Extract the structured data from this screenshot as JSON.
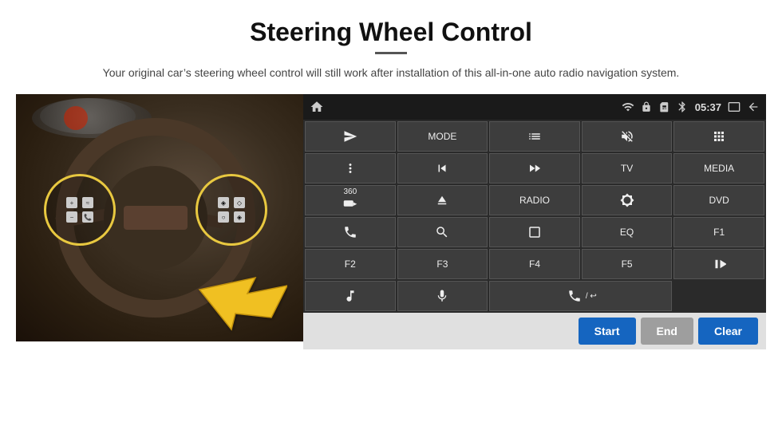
{
  "header": {
    "title": "Steering Wheel Control",
    "subtitle": "Your original car’s steering wheel control will still work after installation of this all-in-one auto radio navigation system."
  },
  "topbar": {
    "time": "05:37",
    "icons": [
      "wifi",
      "lock",
      "sim",
      "volume",
      "mirror",
      "back"
    ]
  },
  "radio_buttons": [
    {
      "id": "r1",
      "type": "icon",
      "icon": "navigate_send",
      "label": ""
    },
    {
      "id": "r2",
      "type": "text",
      "label": "MODE"
    },
    {
      "id": "r3",
      "type": "icon",
      "icon": "list",
      "label": ""
    },
    {
      "id": "r4",
      "type": "icon",
      "icon": "mute",
      "label": ""
    },
    {
      "id": "r5",
      "type": "icon",
      "icon": "apps",
      "label": ""
    },
    {
      "id": "r6",
      "type": "icon",
      "icon": "settings",
      "label": ""
    },
    {
      "id": "r7",
      "type": "icon",
      "icon": "rewind",
      "label": ""
    },
    {
      "id": "r8",
      "type": "icon",
      "icon": "fastforward",
      "label": ""
    },
    {
      "id": "r9",
      "type": "text",
      "label": "TV"
    },
    {
      "id": "r10",
      "type": "text",
      "label": "MEDIA"
    },
    {
      "id": "r11",
      "type": "icon",
      "icon": "360cam",
      "label": ""
    },
    {
      "id": "r12",
      "type": "icon",
      "icon": "eject",
      "label": ""
    },
    {
      "id": "r13",
      "type": "text",
      "label": "RADIO"
    },
    {
      "id": "r14",
      "type": "icon",
      "icon": "brightness",
      "label": ""
    },
    {
      "id": "r15",
      "type": "text",
      "label": "DVD"
    },
    {
      "id": "r16",
      "type": "icon",
      "icon": "phone",
      "label": ""
    },
    {
      "id": "r17",
      "type": "icon",
      "icon": "search",
      "label": ""
    },
    {
      "id": "r18",
      "type": "icon",
      "icon": "rectangle",
      "label": ""
    },
    {
      "id": "r19",
      "type": "text",
      "label": "EQ"
    },
    {
      "id": "r20",
      "type": "text",
      "label": "F1"
    },
    {
      "id": "r21",
      "type": "text",
      "label": "F2"
    },
    {
      "id": "r22",
      "type": "text",
      "label": "F3"
    },
    {
      "id": "r23",
      "type": "text",
      "label": "F4"
    },
    {
      "id": "r24",
      "type": "text",
      "label": "F5"
    },
    {
      "id": "r25",
      "type": "icon",
      "icon": "playpause",
      "label": ""
    },
    {
      "id": "r26",
      "type": "icon",
      "icon": "music",
      "label": ""
    },
    {
      "id": "r27",
      "type": "icon",
      "icon": "mic",
      "label": ""
    },
    {
      "id": "r28",
      "type": "icon",
      "icon": "phone_end",
      "label": ""
    }
  ],
  "bottom_buttons": {
    "start": "Start",
    "end": "End",
    "clear": "Clear"
  },
  "colors": {
    "accent_blue": "#1565c0",
    "panel_bg": "#2a2a2a",
    "topbar_bg": "#1a1a1a",
    "btn_bg": "#3d3d3d"
  }
}
